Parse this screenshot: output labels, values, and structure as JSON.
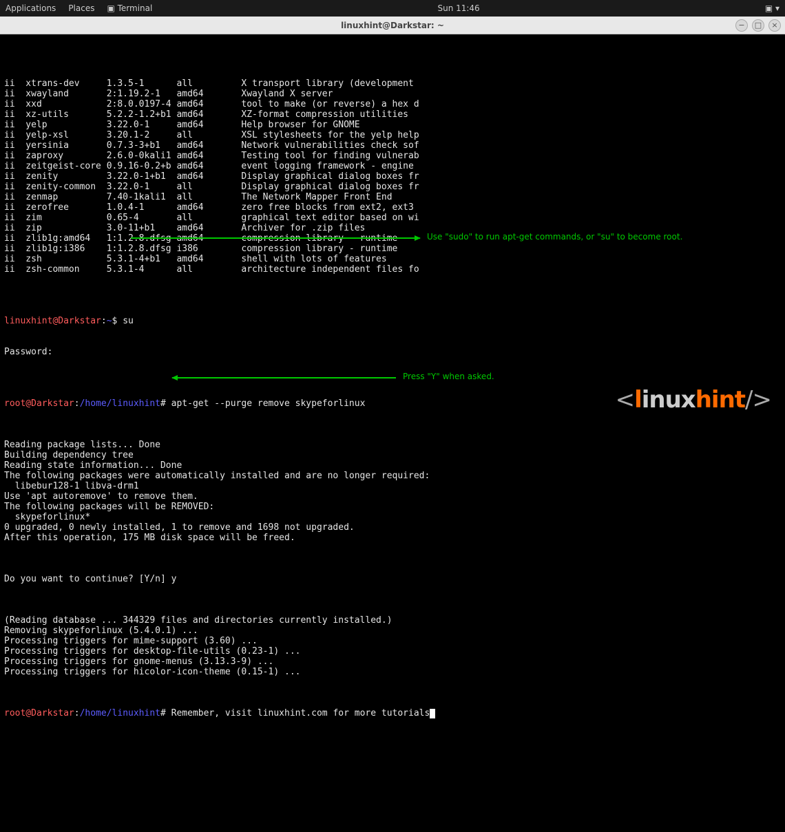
{
  "panel": {
    "applications": "Applications",
    "places": "Places",
    "terminal": "Terminal",
    "clock": "Sun 11:46"
  },
  "titlebar": {
    "title": "linuxhint@Darkstar: ~"
  },
  "pkg_rows": [
    {
      "s": "ii",
      "n": "xtrans-dev",
      "v": "1.3.5-1",
      "a": "all",
      "d": "X transport library (development"
    },
    {
      "s": "ii",
      "n": "xwayland",
      "v": "2:1.19.2-1",
      "a": "amd64",
      "d": "Xwayland X server"
    },
    {
      "s": "ii",
      "n": "xxd",
      "v": "2:8.0.0197-4",
      "a": "amd64",
      "d": "tool to make (or reverse) a hex d"
    },
    {
      "s": "ii",
      "n": "xz-utils",
      "v": "5.2.2-1.2+b1",
      "a": "amd64",
      "d": "XZ-format compression utilities"
    },
    {
      "s": "ii",
      "n": "yelp",
      "v": "3.22.0-1",
      "a": "amd64",
      "d": "Help browser for GNOME"
    },
    {
      "s": "ii",
      "n": "yelp-xsl",
      "v": "3.20.1-2",
      "a": "all",
      "d": "XSL stylesheets for the yelp help"
    },
    {
      "s": "ii",
      "n": "yersinia",
      "v": "0.7.3-3+b1",
      "a": "amd64",
      "d": "Network vulnerabilities check sof"
    },
    {
      "s": "ii",
      "n": "zaproxy",
      "v": "2.6.0-0kali1",
      "a": "amd64",
      "d": "Testing tool for finding vulnerab"
    },
    {
      "s": "ii",
      "n": "zeitgeist-core",
      "v": "0.9.16-0.2+b",
      "a": "amd64",
      "d": "event logging framework - engine"
    },
    {
      "s": "ii",
      "n": "zenity",
      "v": "3.22.0-1+b1",
      "a": "amd64",
      "d": "Display graphical dialog boxes fr"
    },
    {
      "s": "ii",
      "n": "zenity-common",
      "v": "3.22.0-1",
      "a": "all",
      "d": "Display graphical dialog boxes fr"
    },
    {
      "s": "ii",
      "n": "zenmap",
      "v": "7.40-1kali1",
      "a": "all",
      "d": "The Network Mapper Front End"
    },
    {
      "s": "ii",
      "n": "zerofree",
      "v": "1.0.4-1",
      "a": "amd64",
      "d": "zero free blocks from ext2, ext3"
    },
    {
      "s": "ii",
      "n": "zim",
      "v": "0.65-4",
      "a": "all",
      "d": "graphical text editor based on wi"
    },
    {
      "s": "ii",
      "n": "zip",
      "v": "3.0-11+b1",
      "a": "amd64",
      "d": ".zip files"
    },
    {
      "s": "ii",
      "n": "zlib1g:amd64",
      "v": "1:1.2.8.dfsg",
      "a": "amd64",
      "d": "compression library - runtime"
    },
    {
      "s": "ii",
      "n": "zlib1g:i386",
      "v": "1:1.2.8.dfsg",
      "a": "i386",
      "d": "compression library - runtime"
    },
    {
      "s": "ii",
      "n": "zsh",
      "v": "5.3.1-4+b1",
      "a": "amd64",
      "d": "shell with lots of features"
    },
    {
      "s": "ii",
      "n": "zsh-common",
      "v": "5.3.1-4",
      "a": "all",
      "d": "architecture independent files fo"
    }
  ],
  "zip_desc_prefix": "Archiver for ",
  "prompt1_user": "linuxhint@Darkstar",
  "prompt1_sep": ":",
  "prompt1_path": "~",
  "prompt1_sym": "$ ",
  "cmd_su": "su",
  "password_label": "Password:",
  "prompt2_user": "root@Darkstar",
  "prompt2_path": "/home/linuxhint",
  "prompt2_sym": "# ",
  "cmd_apt": "apt-get --purge remove skypeforlinux",
  "apt_out": [
    "Reading package lists... Done",
    "Building dependency tree",
    "Reading state information... Done",
    "The following packages were automatically installed and are no longer required:",
    "  libebur128-1 libva-drm1",
    "Use 'apt autoremove' to remove them.",
    "The following packages will be REMOVED:",
    "  skypeforlinux*",
    "0 upgraded, 0 newly installed, 1 to remove and 1698 not upgraded.",
    "After this operation, 175 MB disk space will be freed."
  ],
  "continue_prompt": "Do you want to continue? [Y/n] ",
  "continue_answer": "y",
  "apt_out2": [
    "(Reading database ... 344329 files and directories currently installed.)",
    "Removing skypeforlinux (5.4.0.1) ...",
    "Processing triggers for mime-support (3.60) ...",
    "Processing triggers for desktop-file-utils (0.23-1) ...",
    "Processing triggers for gnome-menus (3.13.3-9) ...",
    "Processing triggers for hicolor-icon-theme (0.15-1) ..."
  ],
  "cmd_final": "Remember, visit linuxhint.com for more tutorials",
  "annotations": {
    "sudo": "Use \"sudo\" to run apt-get commands, or \"su\" to become root.",
    "pressy": "Press \"Y\" when asked."
  },
  "watermark": {
    "pre": "<",
    "l": "l",
    "inux": "inux",
    "hint": "hint",
    "post": "/>"
  }
}
